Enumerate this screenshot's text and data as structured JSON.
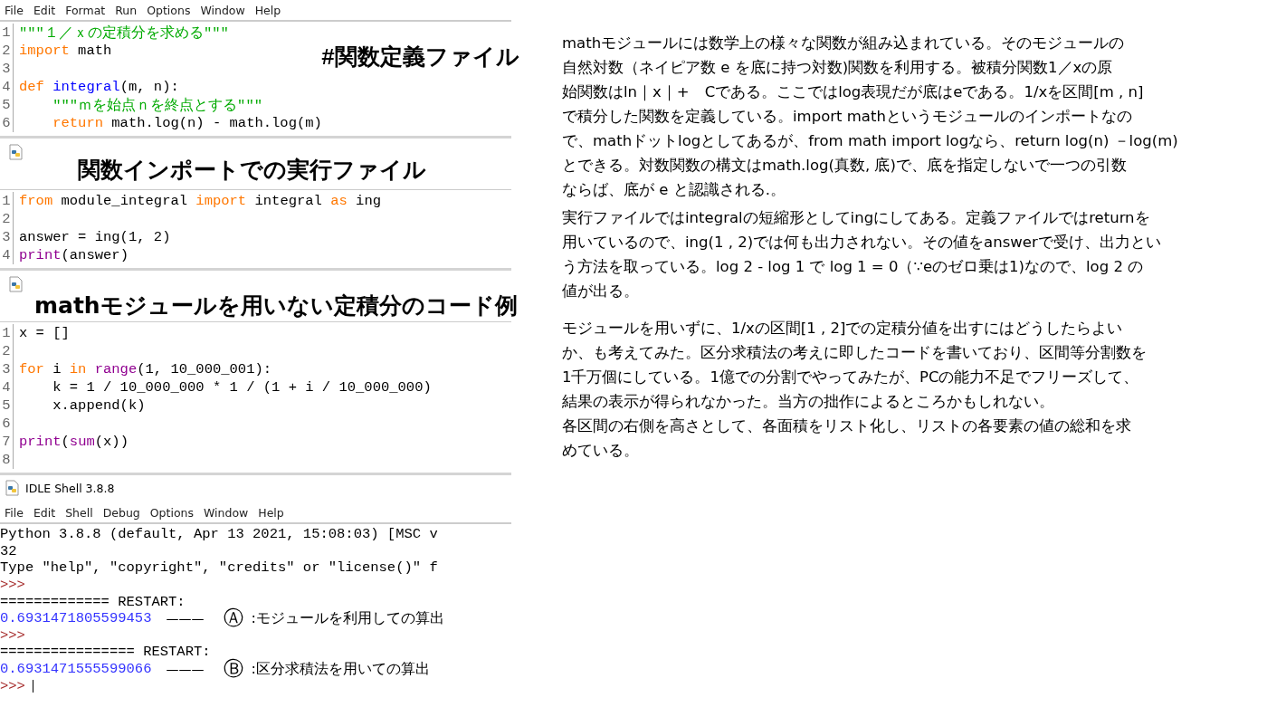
{
  "editor_1": {
    "menu": [
      "File",
      "Edit",
      "Format",
      "Run",
      "Options",
      "Window",
      "Help"
    ],
    "heading": "#関数定義ファイル",
    "lines": [
      {
        "number": "1",
        "segments": [
          {
            "text": "\"\"\"１／ｘの定積分を求める\"\"\"",
            "kind": "string"
          }
        ]
      },
      {
        "number": "2",
        "segments": [
          {
            "text": "import",
            "kind": "keyword"
          },
          {
            "text": " math",
            "kind": "plain"
          }
        ]
      },
      {
        "number": "3"
      },
      {
        "number": "4",
        "segments": [
          {
            "text": "def ",
            "kind": "keyword"
          },
          {
            "text": "integral",
            "kind": "definition"
          },
          {
            "text": "(m, n):",
            "kind": "plain"
          }
        ]
      },
      {
        "number": "5",
        "segments": [
          {
            "text": "    \"\"\"ｍを始点ｎを終点とする\"\"\"",
            "kind": "string"
          }
        ]
      },
      {
        "number": "6",
        "segments": [
          {
            "text": "    return",
            "kind": "keyword"
          },
          {
            "text": " math.log(n) - math.log(m)",
            "kind": "plain"
          }
        ]
      }
    ]
  },
  "editor_2": {
    "heading": "関数インポートでの実行ファイル",
    "lines": [
      {
        "number": "1",
        "segments": [
          {
            "text": "from",
            "kind": "keyword"
          },
          {
            "text": " module_integral ",
            "kind": "plain"
          },
          {
            "text": "import",
            "kind": "keyword"
          },
          {
            "text": " integral ",
            "kind": "plain"
          },
          {
            "text": "as",
            "kind": "keyword"
          },
          {
            "text": " ing",
            "kind": "plain"
          }
        ]
      },
      {
        "number": "2"
      },
      {
        "number": "3",
        "segments": [
          {
            "text": "answer = ing(1, 2)",
            "kind": "plain"
          }
        ]
      },
      {
        "number": "4",
        "segments": [
          {
            "text": "print",
            "kind": "builtin"
          },
          {
            "text": "(answer)",
            "kind": "plain"
          }
        ]
      }
    ]
  },
  "editor_3": {
    "heading": "mathモジュールを用いない定積分のコード例",
    "lines": [
      {
        "number": "1",
        "segments": [
          {
            "text": "x = []",
            "kind": "plain"
          }
        ]
      },
      {
        "number": "2"
      },
      {
        "number": "3",
        "segments": [
          {
            "text": "for",
            "kind": "keyword"
          },
          {
            "text": " i ",
            "kind": "plain"
          },
          {
            "text": "in ",
            "kind": "keyword"
          },
          {
            "text": "range",
            "kind": "builtin"
          },
          {
            "text": "(1, 10_000_001):",
            "kind": "plain"
          }
        ]
      },
      {
        "number": "4",
        "segments": [
          {
            "text": "    k = 1 / 10_000_000 * 1 / (1 + i / 10_000_000)",
            "kind": "plain"
          }
        ]
      },
      {
        "number": "5",
        "segments": [
          {
            "text": "    x.append(k)",
            "kind": "plain"
          }
        ]
      },
      {
        "number": "6"
      },
      {
        "number": "7",
        "segments": [
          {
            "text": "print",
            "kind": "builtin"
          },
          {
            "text": "(",
            "kind": "plain"
          },
          {
            "text": "sum",
            "kind": "builtin"
          },
          {
            "text": "(x))",
            "kind": "plain"
          }
        ]
      },
      {
        "number": "8"
      }
    ]
  },
  "shell": {
    "title": "IDLE Shell 3.8.8",
    "menu": [
      "File",
      "Edit",
      "Shell",
      "Debug",
      "Options",
      "Window",
      "Help"
    ],
    "lines": [
      {
        "text": "Python 3.8.8 (default, Apr 13 2021, 15:08:03) [MSC v",
        "kind": "plain"
      },
      {
        "text": "32",
        "kind": "plain"
      },
      {
        "text": "Type \"help\", \"copyright\", \"credits\" or \"license()\" f",
        "kind": "plain"
      },
      {
        "text": ">>>",
        "kind": "prompt"
      },
      {
        "text": "============= RESTART:",
        "kind": "plain"
      },
      {
        "text": "0.6931471805599453",
        "kind": "output",
        "dash": "———",
        "mark": "Ⓐ",
        "note": ":モジュールを利用しての算出"
      },
      {
        "text": ">>>",
        "kind": "prompt"
      },
      {
        "text": "================ RESTART:",
        "kind": "plain"
      },
      {
        "text": "0.6931471555599066",
        "kind": "output",
        "dash": "———",
        "mark": "Ⓑ",
        "note": ":区分求積法を用いての算出"
      },
      {
        "text": ">>>",
        "kind": "prompt",
        "cursor": true
      }
    ]
  },
  "explanation": [
    [
      "mathモジュールには数学上の様々な関数が組み込まれている。そのモジュールの",
      "自然対数（ネイピア数 e を底に持つ対数)関数を利用する。被積分関数1／xの原",
      "始関数はln｜x｜+　Cである。ここではlog表現だが底はeである。1/xを区間[m , n]",
      "で積分した関数を定義している。import mathというモジュールのインポートなの",
      "で、mathドットlogとしてあるが、from math import logなら、return log(n) －log(m)",
      "とできる。対数関数の構文はmath.log(真数, 底)で、底を指定しないで一つの引数",
      "ならば、底が e と認識される.。"
    ],
    [
      "実行ファイルではintegralの短縮形としてingにしてある。定義ファイルではreturnを",
      "用いているので、ing(1 , 2)では何も出力されない。その値をanswerで受け、出力とい",
      "う方法を取っている。log 2 - log 1 で log 1 = 0（∵eのゼロ乗は1)なので、log 2 の",
      "値が出る。"
    ],
    [
      "モジュールを用いずに、1/xの区間[1 , 2]での定積分値を出すにはどうしたらよい",
      "か、も考えてみた。区分求積法の考えに即したコードを書いており、区間等分割数を",
      "1千万個にしている。1億での分割でやってみたが、PCの能力不足でフリーズして、",
      "結果の表示が得られなかった。当方の拙作によるところかもしれない。",
      "各区間の右側を高さとして、各面積をリスト化し、リストの各要素の値の総和を求",
      "めている。"
    ]
  ]
}
